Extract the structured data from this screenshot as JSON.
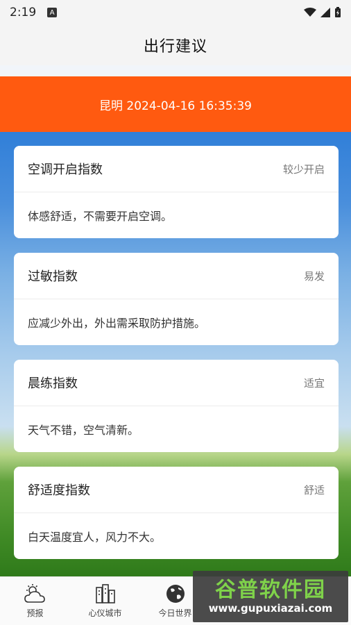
{
  "status_bar": {
    "time": "2:19",
    "notification_icon": "A"
  },
  "header": {
    "title": "出行建议"
  },
  "banner": {
    "text": "昆明 2024-04-16 16:35:39"
  },
  "cards": [
    {
      "title": "空调开启指数",
      "level": "较少开启",
      "desc": "体感舒适，不需要开启空调。"
    },
    {
      "title": "过敏指数",
      "level": "易发",
      "desc": "应减少外出，外出需采取防护措施。"
    },
    {
      "title": "晨练指数",
      "level": "适宜",
      "desc": "天气不错，空气清新。"
    },
    {
      "title": "舒适度指数",
      "level": "舒适",
      "desc": "白天温度宜人，风力不大。"
    }
  ],
  "tabs": [
    {
      "label": "预报",
      "icon": "weather-icon"
    },
    {
      "label": "心仪城市",
      "icon": "city-icon"
    },
    {
      "label": "今日世界",
      "icon": "globe-icon"
    }
  ],
  "watermark": {
    "main": "谷普软件园",
    "url": "www.gupuxiazai.com"
  },
  "colors": {
    "banner": "#ff5a10",
    "watermark_green": "#7fd24a"
  }
}
